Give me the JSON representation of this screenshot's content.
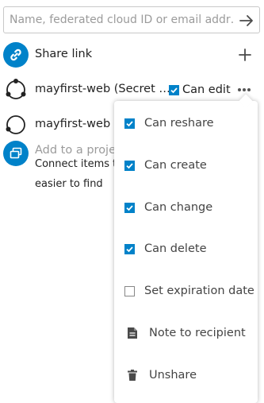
{
  "search": {
    "placeholder": "Name, federated cloud ID or email addr…"
  },
  "share_link": {
    "label": "Share link"
  },
  "shares": [
    {
      "name": "mayfirst-web (Secret …",
      "permission_label": "Can edit",
      "permission_checked": true
    },
    {
      "name": "mayfirst-web ("
    }
  ],
  "project": {
    "add_label": "Add to a proje",
    "desc_line1": "Connect items t",
    "desc_line2": "easier to find"
  },
  "menu": {
    "items": [
      {
        "label": "Can reshare",
        "type": "checkbox",
        "checked": true
      },
      {
        "label": "Can create",
        "type": "checkbox",
        "checked": true
      },
      {
        "label": "Can change",
        "type": "checkbox",
        "checked": true
      },
      {
        "label": "Can delete",
        "type": "checkbox",
        "checked": true
      },
      {
        "label": "Set expiration date",
        "type": "checkbox",
        "checked": false
      },
      {
        "label": "Note to recipient",
        "type": "action",
        "icon": "note-icon"
      },
      {
        "label": "Unshare",
        "type": "action",
        "icon": "trash-icon"
      }
    ]
  },
  "colors": {
    "accent": "#0082c9",
    "text": "#222222",
    "muted": "#9b9b9b"
  }
}
